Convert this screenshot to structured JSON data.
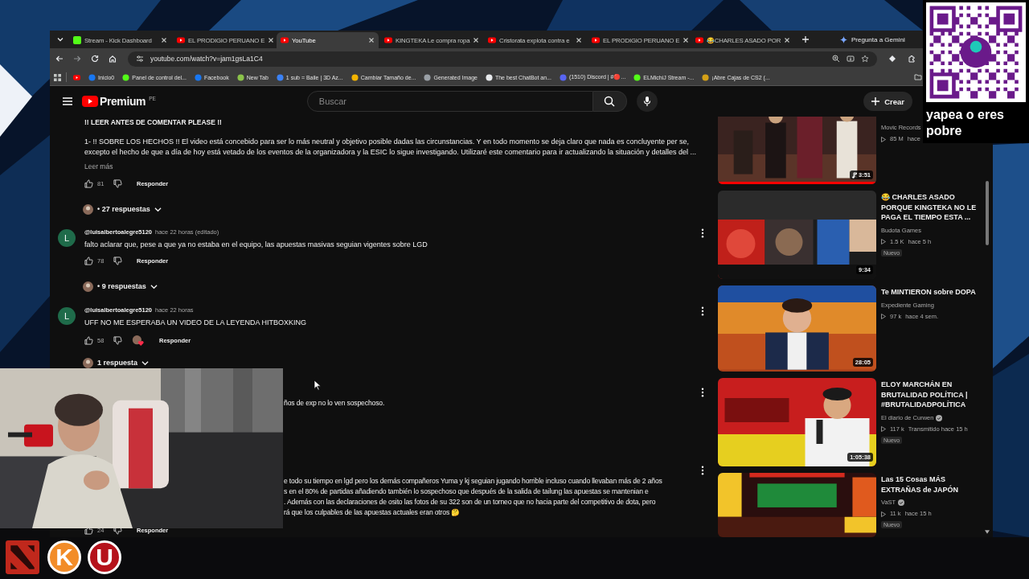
{
  "tabs": [
    {
      "title": "Stream - Kick Dashboard",
      "selected": false
    },
    {
      "title": "EL PRODIGIO PERUANO E",
      "selected": false
    },
    {
      "title": "YouTube",
      "selected": true
    },
    {
      "title": "KINGTEKA Le compra ropa",
      "selected": false
    },
    {
      "title": "Cristorata explota contra e",
      "selected": false
    },
    {
      "title": "EL PRODIGIO PERUANO E",
      "selected": false
    },
    {
      "title": "😂CHARLES ASADO POR",
      "selected": false
    }
  ],
  "gemini_button": "Pregunta a Gemini",
  "address": "youtube.com/watch?v=jam1gsLa1C4",
  "bookmarks": [
    {
      "kind": "icon_only"
    },
    {
      "kind": "labelled",
      "label": "Inicio0"
    },
    {
      "kind": "labelled",
      "label": "Panel de control del..."
    },
    {
      "kind": "labelled",
      "label": "Facebook"
    },
    {
      "kind": "labelled",
      "label": "New Tab"
    },
    {
      "kind": "labelled",
      "label": "1 sub = Baile | 3D Az..."
    },
    {
      "kind": "labelled",
      "label": "Cambiar Tamaño de..."
    },
    {
      "kind": "labelled",
      "label": "Generated Image"
    },
    {
      "kind": "labelled",
      "label": "The best ChatBot an..."
    },
    {
      "kind": "labelled",
      "label": "(1510) Discord | #🔴..."
    },
    {
      "kind": "labelled",
      "label": "ELMichiJ Stream -..."
    },
    {
      "kind": "labelled",
      "label": "¡Abre Cajas de CS2 (..."
    }
  ],
  "header": {
    "logo_text": "Premium",
    "region": "PE",
    "search_placeholder": "Buscar",
    "create_button": "Crear"
  },
  "comments": [
    {
      "kind": "full",
      "title": "!! LEER ANTES DE COMENTAR PLEASE !!",
      "text": "1- !! SOBRE LOS HECHOS !! El video está concebido para ser lo más neutral y objetivo posible dadas las circunstancias. Y en todo momento se deja claro que nada es concluyente per se, excepto el hecho de que a día de hoy está vetado de los eventos de la organizadora y la ESIC lo sigue investigando. Utilizaré este comentario para ir actualizando la situación y detalles del ...",
      "more": "Leer más",
      "likes": "81",
      "reply": "Responder",
      "creator_heart": false,
      "replies": "• 27 respuestas",
      "menu": false
    },
    {
      "kind": "full",
      "avatar": "L",
      "author": "@luisalbertoalegre5120",
      "time": "hace 22 horas (editado)",
      "text": "falto aclarar que, pese a que ya no estaba en el equipo, las apuestas masivas seguian vigentes sobre LGD",
      "likes": "78",
      "reply": "Responder",
      "creator_heart": false,
      "replies": "• 9 respuestas",
      "menu": true
    },
    {
      "kind": "full",
      "avatar": "L",
      "author": "@luisalbertoalegre5120",
      "time": "hace 22 horas",
      "text": "UFF NO ME ESPERABA UN VIDEO DE LA LEYENDA HITBOXKING",
      "likes": "58",
      "reply": "Responder",
      "creator_heart": true,
      "replies": "1 respuesta",
      "menu": true
    },
    {
      "kind": "cut",
      "lines": [
        "ños de exp no lo ven sospechoso."
      ],
      "menu": true
    },
    {
      "kind": "cut",
      "lines": [
        "e todo su tiempo en lgd pero los demás compañeros Yuma y kj seguian jugando horrible incluso cuando llevaban más de 2 años",
        "s en el 80% de partidas añadiendo también lo sospechoso que después de la salida de tailung las apuestas se mantenian e",
        ". Además con las declaraciones de osito las fotos de su 322 son de un torneo que no hacia parte del competitivo de dota, pero",
        "rá que los culpables de las apuestas actuales eran otros 🤔"
      ],
      "likes": "24",
      "reply": "Responder",
      "menu": true
    }
  ],
  "videos": [
    {
      "channel": "Movic Records",
      "verified": false,
      "views": "85 M",
      "age": "hace",
      "duration": "3:51",
      "music": true,
      "level": 1
    },
    {
      "title": "😂 CHARLES ASADO PORQUE KINGTEKA NO LE PAGA EL TIEMPO ESTA ...",
      "channel": "Budota Games",
      "verified": false,
      "views": "1.5 K",
      "age": "hace 5 h",
      "badge": "Nuevo",
      "duration": "9:34",
      "music": false
    },
    {
      "title": "Te MINTIERON sobre DOPA",
      "channel": "Expediente Gaming",
      "verified": false,
      "views": "97 k",
      "age": "hace 4 sem.",
      "duration": "28:05",
      "music": false
    },
    {
      "title": "ELOY MARCHÁN EN BRUTALIDAD POLÍTICA | #BRUTALIDADPOLÍTICA",
      "channel": "El diario de Curwen",
      "verified": true,
      "views": "117 k",
      "age": "Transmitido hace 15 h",
      "badge": "Nuevo",
      "duration": "1:05:38",
      "music": false
    },
    {
      "title": "Las 15 Cosas MÁS EXTRAÑAS de JAPÓN",
      "channel": "VaST",
      "verified": true,
      "views": "11 k",
      "age": "hace 15 h",
      "badge": "Nuevo"
    }
  ],
  "qr_caption": "yapea o eres pobre",
  "dock": [
    {
      "kind": "dota",
      "color": "#c0281c"
    },
    {
      "kind": "letter",
      "text": "K",
      "color": "#f28c28"
    },
    {
      "kind": "letter",
      "text": "U",
      "color": "#b5121b"
    }
  ]
}
